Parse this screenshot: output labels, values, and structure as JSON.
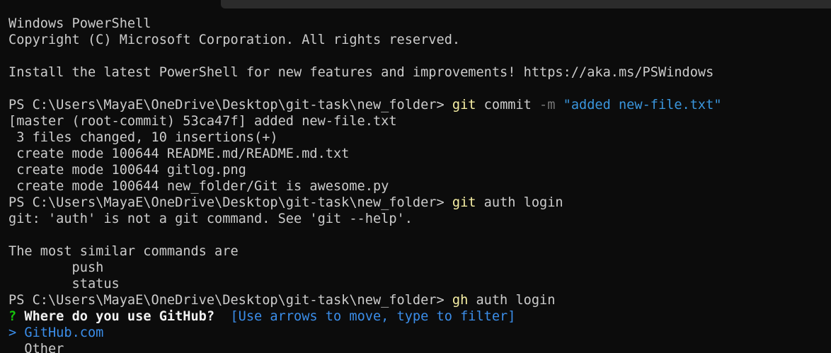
{
  "window": {
    "header_lines": [
      "Windows PowerShell",
      "Copyright (C) Microsoft Corporation. All rights reserved.",
      "",
      "Install the latest PowerShell for new features and improvements! https://aka.ms/PSWindows",
      ""
    ]
  },
  "session": {
    "prompt": "PS C:\\Users\\MayaE\\OneDrive\\Desktop\\git-task\\new_folder> ",
    "cmd1": {
      "exe": "git",
      "args": " commit ",
      "flag": "-m",
      "string": " \"added new-file.txt\""
    },
    "cmd1_output": [
      "[master (root-commit) 53ca47f] added new-file.txt",
      " 3 files changed, 10 insertions(+)",
      " create mode 100644 README.md/README.md.txt",
      " create mode 100644 gitlog.png",
      " create mode 100644 new_folder/Git is awesome.py"
    ],
    "cmd2": {
      "exe": "git",
      "args": " auth login"
    },
    "cmd2_output": [
      "git: 'auth' is not a git command. See 'git --help'.",
      "",
      "The most similar commands are",
      "        push",
      "        status"
    ],
    "cmd3": {
      "exe": "gh",
      "args": " auth login"
    },
    "question": {
      "mark": "?",
      "text": " Where do you use GitHub?  ",
      "hint": "[Use arrows to move, type to filter]"
    },
    "options": {
      "selected_marker": ">",
      "selected": " GitHub.com",
      "other": "  Other"
    }
  },
  "colors": {
    "background": "#0c0c0c",
    "foreground": "#cccccc",
    "command": "#f9f1a5",
    "flag": "#767676",
    "string": "#3a96dd",
    "question_mark": "#16c60c",
    "hint": "#3b8eea"
  }
}
